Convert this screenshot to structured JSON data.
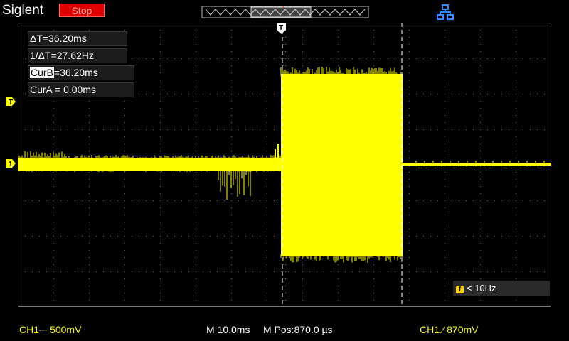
{
  "header": {
    "brand": "Siglent",
    "run_status": "Stop",
    "run_status_color": "#e00000"
  },
  "icons": {
    "connection": "usb-network-icon",
    "trigger_level": "trigger-level-marker-icon",
    "channel_ground": "channel1-ground-marker-icon",
    "trigger_position": "trigger-position-marker-icon"
  },
  "measurements": {
    "delta_t": "ΔT=36.20ms",
    "inv_delta_t": "1/ΔT=27.62Hz",
    "cur_b_tag": "CurB",
    "cur_b_value": "=36.20ms",
    "cur_a": "CurA = 0.00ms"
  },
  "markers": {
    "trigger_level_label": "T",
    "channel1_label": "1",
    "trigger_pos_label": "T"
  },
  "trigger_frequency": {
    "badge": "f",
    "text": "< 10Hz"
  },
  "status_bar": {
    "ch1_scale": "CH1⎓ 500mV",
    "timebase": "M 10.0ms",
    "mpos": "M Pos:870.0 µs",
    "trigger": "CH1 ⁄ 870mV"
  },
  "colors": {
    "trace": "#ffff00",
    "grid": "#6e6e6e",
    "cursor": "#ffffff"
  }
}
